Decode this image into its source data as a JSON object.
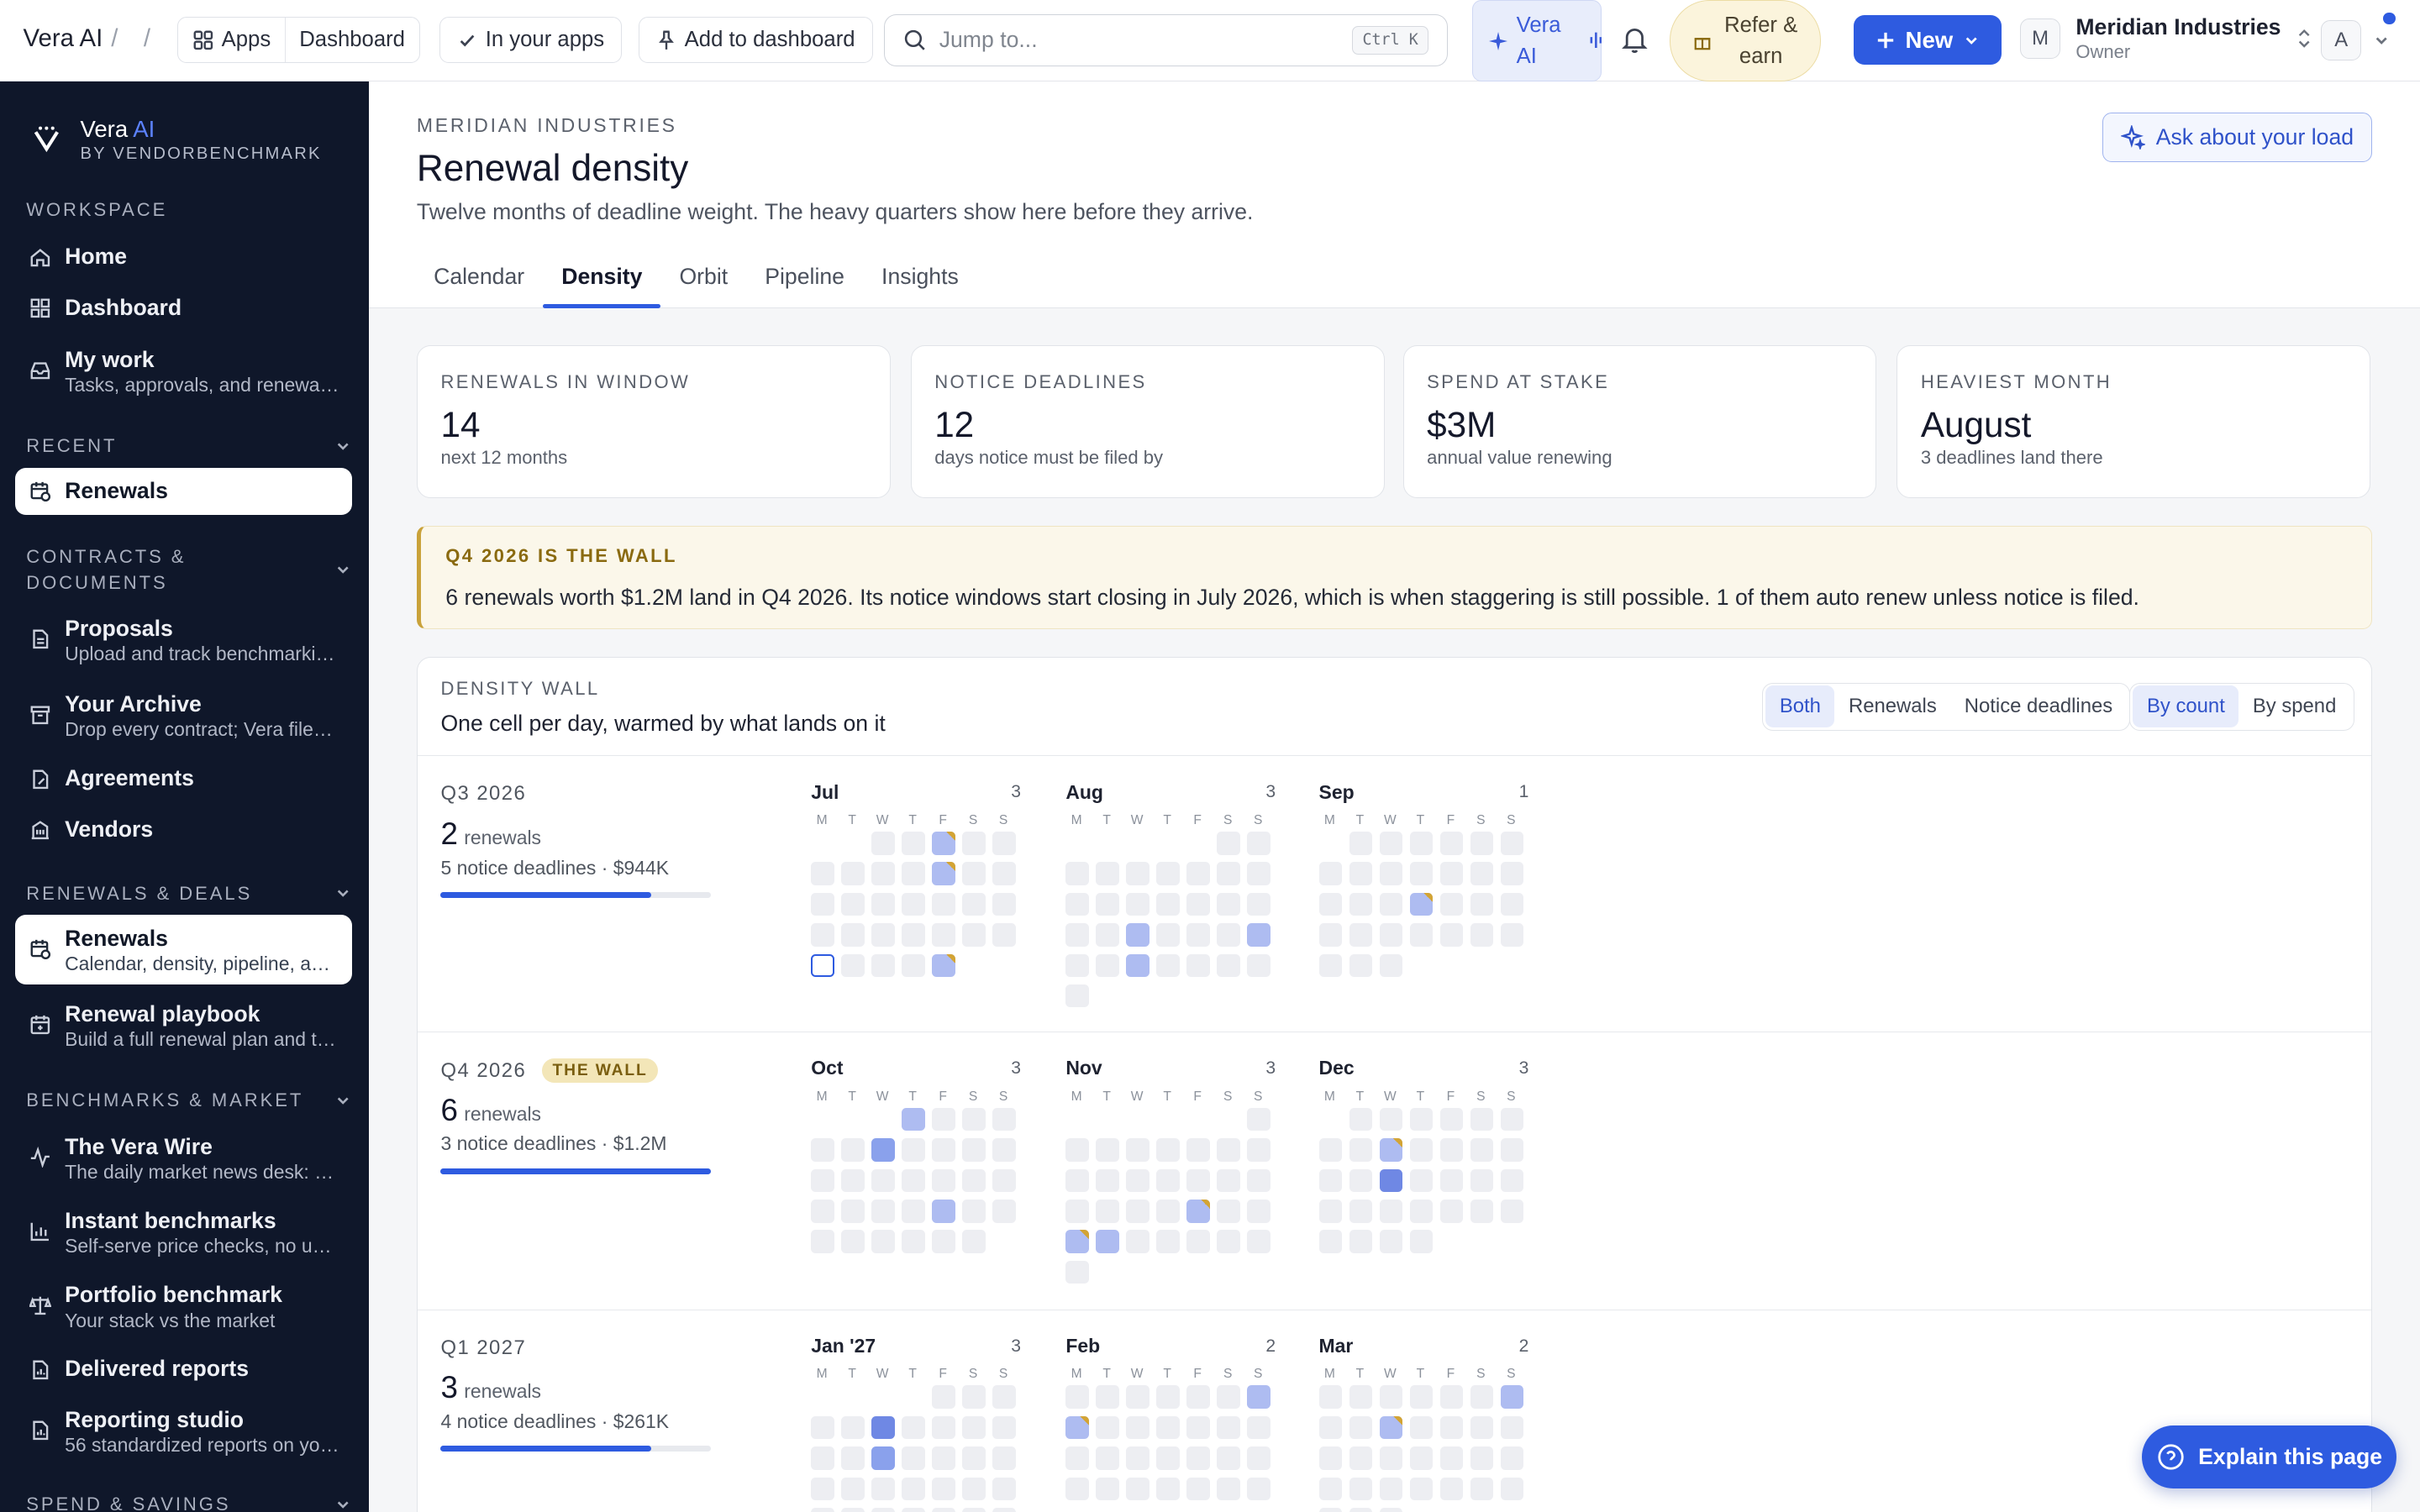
{
  "topbar": {
    "brand": "Vera AI",
    "slash": "/",
    "apps_label": "Apps",
    "dashboard_label": "Dashboard",
    "in_apps_label": "In your apps",
    "add_dashboard_label": "Add to dashboard",
    "search_placeholder": "Jump to...",
    "search_kbd": "Ctrl K",
    "vera_line1": "Vera",
    "vera_line2": "AI",
    "refer_line1": "Refer &",
    "refer_line2": "earn",
    "new_label": "New",
    "org_initial": "M",
    "org_name": "Meridian Industries",
    "org_role": "Owner",
    "user_initial": "A"
  },
  "sidebar": {
    "logo_title": "Vera",
    "logo_ai": "AI",
    "logo_sub": "BY VENDORBENCHMARK",
    "sections": {
      "workspace": "WORKSPACE",
      "recent": "RECENT",
      "contracts_1": "CONTRACTS &",
      "contracts_2": "DOCUMENTS",
      "renewals": "RENEWALS & DEALS",
      "benchmarks": "BENCHMARKS & MARKET",
      "spend": "SPEND & SAVINGS"
    },
    "items": {
      "home": {
        "label": "Home"
      },
      "dashboard": {
        "label": "Dashboard"
      },
      "mywork": {
        "label": "My work",
        "sub": "Tasks, approvals, and renewals ..."
      },
      "recent_renewals": {
        "label": "Renewals"
      },
      "proposals": {
        "label": "Proposals",
        "sub": "Upload and track benchmarkin..."
      },
      "archive": {
        "label": "Your Archive",
        "sub": "Drop every contract; Vera files t..."
      },
      "agreements": {
        "label": "Agreements"
      },
      "vendors": {
        "label": "Vendors"
      },
      "renewals": {
        "label": "Renewals",
        "sub": "Calendar, density, pipeline, and..."
      },
      "playbook": {
        "label": "Renewal playbook",
        "sub": "Build a full renewal plan and tu..."
      },
      "wire": {
        "label": "The Vera Wire",
        "sub": "The daily market news desk: pri..."
      },
      "instant": {
        "label": "Instant benchmarks",
        "sub": "Self-serve price checks, no uplo..."
      },
      "portfolio": {
        "label": "Portfolio benchmark",
        "sub": "Your stack vs the market"
      },
      "delivered": {
        "label": "Delivered reports"
      },
      "studio": {
        "label": "Reporting studio",
        "sub": "56 standardized reports on you..."
      }
    }
  },
  "page": {
    "eyebrow": "MERIDIAN INDUSTRIES",
    "title": "Renewal density",
    "description": "Twelve months of deadline weight. The heavy quarters show here before they arrive.",
    "ask_label": "Ask about your load",
    "tabs": [
      "Calendar",
      "Density",
      "Orbit",
      "Pipeline",
      "Insights"
    ]
  },
  "stats": [
    {
      "label": "RENEWALS IN WINDOW",
      "value": "14",
      "sub": "next 12 months"
    },
    {
      "label": "NOTICE DEADLINES",
      "value": "12",
      "sub": "days notice must be filed by"
    },
    {
      "label": "SPEND AT STAKE",
      "value": "$3M",
      "sub": "annual value renewing"
    },
    {
      "label": "HEAVIEST MONTH",
      "value": "August",
      "sub": "3 deadlines land there"
    }
  ],
  "alert": {
    "title": "Q4 2026 IS THE WALL",
    "body": "6 renewals worth $1.2M land in Q4 2026. Its notice windows start closing in July 2026, which is when staggering is still possible. 1 of them auto renew unless notice is filed."
  },
  "wall": {
    "label": "DENSITY WALL",
    "title": "One cell per day, warmed by what lands on it",
    "filter_options": [
      "Both",
      "Renewals",
      "Notice deadlines"
    ],
    "filter_selected": "Both",
    "metric_options": [
      "By count",
      "By spend"
    ],
    "metric_selected": "By count",
    "weekdays": [
      "M",
      "T",
      "W",
      "T",
      "F",
      "S",
      "S"
    ]
  },
  "quarters": [
    {
      "name": "Q3 2026",
      "badge": "",
      "count": "2",
      "count_label": "renewals",
      "sub": "5 notice deadlines · $944K",
      "load": 0.78
    },
    {
      "name": "Q4 2026",
      "badge": "THE WALL",
      "count": "6",
      "count_label": "renewals",
      "sub": "3 notice deadlines · $1.2M",
      "load": 1.0
    },
    {
      "name": "Q1 2027",
      "badge": "",
      "count": "3",
      "count_label": "renewals",
      "sub": "4 notice deadlines · $261K",
      "load": 0.78
    }
  ],
  "months": [
    {
      "name": "Jul",
      "count": "3",
      "offset": 2,
      "days": 31,
      "marks": [
        {
          "d": 3,
          "l": 1,
          "n": true
        },
        {
          "d": 10,
          "l": 1,
          "n": true
        },
        {
          "d": 27,
          "l": 0,
          "t": true
        },
        {
          "d": 31,
          "l": 1,
          "n": true
        }
      ]
    },
    {
      "name": "Aug",
      "count": "3",
      "offset": 5,
      "days": 31,
      "marks": [
        {
          "d": 19,
          "l": 1
        },
        {
          "d": 23,
          "l": 1
        },
        {
          "d": 26,
          "l": 1
        }
      ]
    },
    {
      "name": "Sep",
      "count": "1",
      "offset": 1,
      "days": 30,
      "marks": [
        {
          "d": 17,
          "l": 1,
          "n": true
        }
      ]
    },
    {
      "name": "Oct",
      "count": "3",
      "offset": 3,
      "days": 31,
      "marks": [
        {
          "d": 1,
          "l": 1
        },
        {
          "d": 7,
          "l": 2
        },
        {
          "d": 23,
          "l": 1
        }
      ]
    },
    {
      "name": "Nov",
      "count": "3",
      "offset": 6,
      "days": 30,
      "marks": [
        {
          "d": 20,
          "l": 1,
          "n": true
        },
        {
          "d": 23,
          "l": 1,
          "n": true
        },
        {
          "d": 24,
          "l": 1
        }
      ]
    },
    {
      "name": "Dec",
      "count": "3",
      "offset": 1,
      "days": 31,
      "marks": [
        {
          "d": 9,
          "l": 1,
          "n": true
        },
        {
          "d": 16,
          "l": 3
        }
      ]
    },
    {
      "name": "Jan '27",
      "count": "3",
      "offset": 4,
      "days": 31,
      "marks": [
        {
          "d": 6,
          "l": 3
        },
        {
          "d": 13,
          "l": 2
        }
      ]
    },
    {
      "name": "Feb",
      "count": "2",
      "offset": 0,
      "days": 28,
      "marks": [
        {
          "d": 7,
          "l": 1
        },
        {
          "d": 8,
          "l": 1,
          "n": true
        }
      ]
    },
    {
      "name": "Mar",
      "count": "2",
      "offset": 0,
      "days": 31,
      "marks": [
        {
          "d": 7,
          "l": 1
        },
        {
          "d": 10,
          "l": 1,
          "n": true
        }
      ]
    }
  ],
  "explain_label": "Explain this page"
}
